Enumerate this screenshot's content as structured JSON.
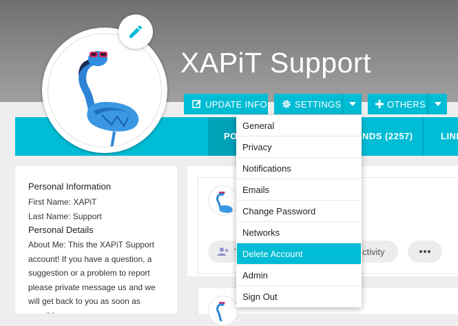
{
  "profile": {
    "name": "XAPiT Support",
    "buttons": {
      "update_info": "UPDATE INFO",
      "settings": "SETTINGS",
      "others": "OTHERS"
    },
    "nav_tabs": [
      {
        "label": "POS"
      },
      {
        "label": "NDS  (2257)"
      },
      {
        "label": "LINK"
      }
    ]
  },
  "settings_menu": {
    "items": [
      {
        "label": "General"
      },
      {
        "label": "Privacy"
      },
      {
        "label": "Notifications"
      },
      {
        "label": "Emails"
      },
      {
        "label": "Change Password"
      },
      {
        "label": "Networks"
      },
      {
        "label": "Delete Account",
        "highlighted": true
      },
      {
        "label": "Admin"
      },
      {
        "label": "Sign Out"
      }
    ]
  },
  "sidebar": {
    "personal_info_heading": "Personal Information",
    "first_name": "First Name: XAPiT",
    "last_name": "Last Name: Support",
    "personal_details_heading": "Personal Details",
    "about_me": "About Me: This the XAPiT Support account! If you have a question, a suggestion or a problem to report please private message us and we will get back to you as soon as possible"
  },
  "feed": {
    "add_button_label": "T",
    "activity_label": "ctivity",
    "more_icon": "ellipsis-icon"
  },
  "colors": {
    "accent": "#00bcd4",
    "accent_dark": "#00a2b8",
    "cover": "#8a8a8a",
    "background": "#eeeeee"
  }
}
